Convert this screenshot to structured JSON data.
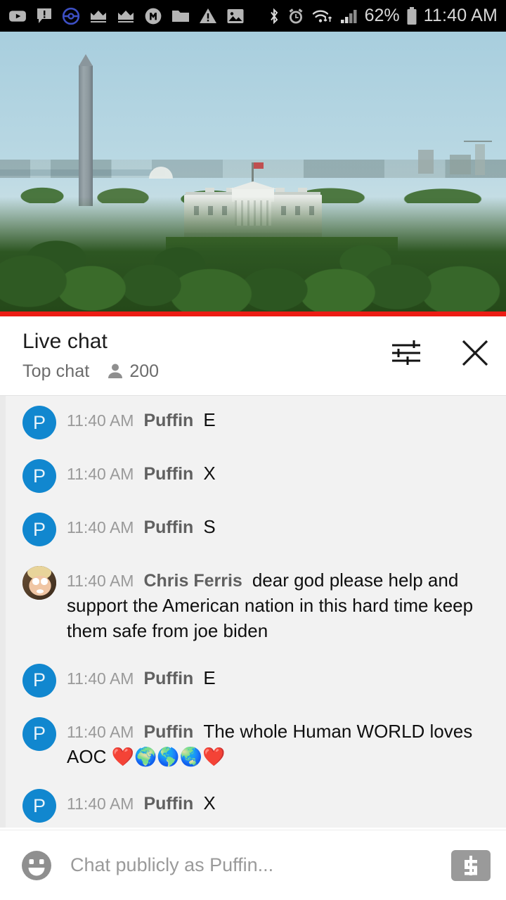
{
  "statusbar": {
    "left_icons": [
      {
        "name": "youtube-icon"
      },
      {
        "name": "chat-alert-icon"
      },
      {
        "name": "pokeball-icon"
      },
      {
        "name": "crown-icon-1"
      },
      {
        "name": "crown-icon-2"
      },
      {
        "name": "m-badge-icon"
      },
      {
        "name": "folder-icon"
      },
      {
        "name": "warning-triangle-icon"
      },
      {
        "name": "image-icon"
      }
    ],
    "right_icons": [
      {
        "name": "bluetooth-icon"
      },
      {
        "name": "alarm-clock-icon"
      },
      {
        "name": "wifi-transfer-icon"
      },
      {
        "name": "cellular-signal-icon"
      }
    ],
    "battery_percent": "62%",
    "clock": "11:40 AM"
  },
  "video": {
    "alt": "Live aerial view of the White House and Washington Monument",
    "progress_color": "#ec1c14"
  },
  "chat_header": {
    "title": "Live chat",
    "mode": "Top chat",
    "viewer_count": "200",
    "settings_icon": "sliders-icon",
    "close_icon": "close-icon"
  },
  "messages": [
    {
      "avatar_type": "initial",
      "avatar_initial": "P",
      "time": "11:40 AM",
      "author": "Puffin",
      "text": "E"
    },
    {
      "avatar_type": "initial",
      "avatar_initial": "P",
      "time": "11:40 AM",
      "author": "Puffin",
      "text": "X"
    },
    {
      "avatar_type": "initial",
      "avatar_initial": "P",
      "time": "11:40 AM",
      "author": "Puffin",
      "text": "S"
    },
    {
      "avatar_type": "photo",
      "avatar_initial": "",
      "time": "11:40 AM",
      "author": "Chris Ferris",
      "text": "dear god please help and support the American nation in this hard time keep them safe from joe biden"
    },
    {
      "avatar_type": "initial",
      "avatar_initial": "P",
      "time": "11:40 AM",
      "author": "Puffin",
      "text": "E"
    },
    {
      "avatar_type": "initial",
      "avatar_initial": "P",
      "time": "11:40 AM",
      "author": "Puffin",
      "text": "The whole Human WORLD loves AOC ❤️🌍🌎🌏❤️"
    },
    {
      "avatar_type": "initial",
      "avatar_initial": "P",
      "time": "11:40 AM",
      "author": "Puffin",
      "text": "X"
    }
  ],
  "input_bar": {
    "emoji_icon": "emoji-smiley-icon",
    "placeholder": "Chat publicly as Puffin...",
    "superchat_icon": "dollar-superchat-icon",
    "value": ""
  },
  "colors": {
    "avatar_blue": "#1187cf",
    "progress_red": "#ec1c14",
    "chat_bg": "#f2f2f2"
  }
}
